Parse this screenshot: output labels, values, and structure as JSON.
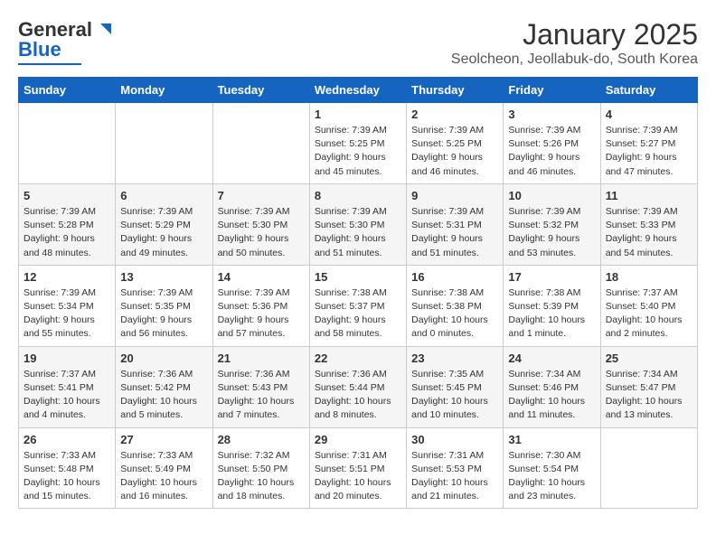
{
  "logo": {
    "general": "General",
    "blue": "Blue"
  },
  "title": "January 2025",
  "subtitle": "Seolcheon, Jeollabuk-do, South Korea",
  "weekdays": [
    "Sunday",
    "Monday",
    "Tuesday",
    "Wednesday",
    "Thursday",
    "Friday",
    "Saturday"
  ],
  "weeks": [
    [
      {
        "day": "",
        "info": ""
      },
      {
        "day": "",
        "info": ""
      },
      {
        "day": "",
        "info": ""
      },
      {
        "day": "1",
        "info": "Sunrise: 7:39 AM\nSunset: 5:25 PM\nDaylight: 9 hours\nand 45 minutes."
      },
      {
        "day": "2",
        "info": "Sunrise: 7:39 AM\nSunset: 5:25 PM\nDaylight: 9 hours\nand 46 minutes."
      },
      {
        "day": "3",
        "info": "Sunrise: 7:39 AM\nSunset: 5:26 PM\nDaylight: 9 hours\nand 46 minutes."
      },
      {
        "day": "4",
        "info": "Sunrise: 7:39 AM\nSunset: 5:27 PM\nDaylight: 9 hours\nand 47 minutes."
      }
    ],
    [
      {
        "day": "5",
        "info": "Sunrise: 7:39 AM\nSunset: 5:28 PM\nDaylight: 9 hours\nand 48 minutes."
      },
      {
        "day": "6",
        "info": "Sunrise: 7:39 AM\nSunset: 5:29 PM\nDaylight: 9 hours\nand 49 minutes."
      },
      {
        "day": "7",
        "info": "Sunrise: 7:39 AM\nSunset: 5:30 PM\nDaylight: 9 hours\nand 50 minutes."
      },
      {
        "day": "8",
        "info": "Sunrise: 7:39 AM\nSunset: 5:30 PM\nDaylight: 9 hours\nand 51 minutes."
      },
      {
        "day": "9",
        "info": "Sunrise: 7:39 AM\nSunset: 5:31 PM\nDaylight: 9 hours\nand 51 minutes."
      },
      {
        "day": "10",
        "info": "Sunrise: 7:39 AM\nSunset: 5:32 PM\nDaylight: 9 hours\nand 53 minutes."
      },
      {
        "day": "11",
        "info": "Sunrise: 7:39 AM\nSunset: 5:33 PM\nDaylight: 9 hours\nand 54 minutes."
      }
    ],
    [
      {
        "day": "12",
        "info": "Sunrise: 7:39 AM\nSunset: 5:34 PM\nDaylight: 9 hours\nand 55 minutes."
      },
      {
        "day": "13",
        "info": "Sunrise: 7:39 AM\nSunset: 5:35 PM\nDaylight: 9 hours\nand 56 minutes."
      },
      {
        "day": "14",
        "info": "Sunrise: 7:39 AM\nSunset: 5:36 PM\nDaylight: 9 hours\nand 57 minutes."
      },
      {
        "day": "15",
        "info": "Sunrise: 7:38 AM\nSunset: 5:37 PM\nDaylight: 9 hours\nand 58 minutes."
      },
      {
        "day": "16",
        "info": "Sunrise: 7:38 AM\nSunset: 5:38 PM\nDaylight: 10 hours\nand 0 minutes."
      },
      {
        "day": "17",
        "info": "Sunrise: 7:38 AM\nSunset: 5:39 PM\nDaylight: 10 hours\nand 1 minute."
      },
      {
        "day": "18",
        "info": "Sunrise: 7:37 AM\nSunset: 5:40 PM\nDaylight: 10 hours\nand 2 minutes."
      }
    ],
    [
      {
        "day": "19",
        "info": "Sunrise: 7:37 AM\nSunset: 5:41 PM\nDaylight: 10 hours\nand 4 minutes."
      },
      {
        "day": "20",
        "info": "Sunrise: 7:36 AM\nSunset: 5:42 PM\nDaylight: 10 hours\nand 5 minutes."
      },
      {
        "day": "21",
        "info": "Sunrise: 7:36 AM\nSunset: 5:43 PM\nDaylight: 10 hours\nand 7 minutes."
      },
      {
        "day": "22",
        "info": "Sunrise: 7:36 AM\nSunset: 5:44 PM\nDaylight: 10 hours\nand 8 minutes."
      },
      {
        "day": "23",
        "info": "Sunrise: 7:35 AM\nSunset: 5:45 PM\nDaylight: 10 hours\nand 10 minutes."
      },
      {
        "day": "24",
        "info": "Sunrise: 7:34 AM\nSunset: 5:46 PM\nDaylight: 10 hours\nand 11 minutes."
      },
      {
        "day": "25",
        "info": "Sunrise: 7:34 AM\nSunset: 5:47 PM\nDaylight: 10 hours\nand 13 minutes."
      }
    ],
    [
      {
        "day": "26",
        "info": "Sunrise: 7:33 AM\nSunset: 5:48 PM\nDaylight: 10 hours\nand 15 minutes."
      },
      {
        "day": "27",
        "info": "Sunrise: 7:33 AM\nSunset: 5:49 PM\nDaylight: 10 hours\nand 16 minutes."
      },
      {
        "day": "28",
        "info": "Sunrise: 7:32 AM\nSunset: 5:50 PM\nDaylight: 10 hours\nand 18 minutes."
      },
      {
        "day": "29",
        "info": "Sunrise: 7:31 AM\nSunset: 5:51 PM\nDaylight: 10 hours\nand 20 minutes."
      },
      {
        "day": "30",
        "info": "Sunrise: 7:31 AM\nSunset: 5:53 PM\nDaylight: 10 hours\nand 21 minutes."
      },
      {
        "day": "31",
        "info": "Sunrise: 7:30 AM\nSunset: 5:54 PM\nDaylight: 10 hours\nand 23 minutes."
      },
      {
        "day": "",
        "info": ""
      }
    ]
  ]
}
